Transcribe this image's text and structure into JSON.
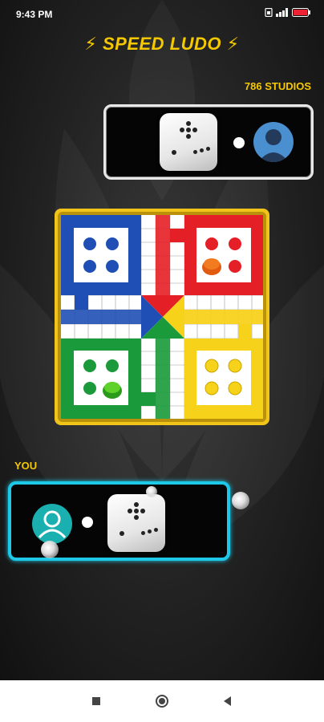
{
  "status_bar": {
    "time": "9:43 PM",
    "icons": [
      "sim-icon",
      "signal-icon",
      "battery-icon"
    ],
    "battery": "11"
  },
  "header": {
    "title": "SPEED LUDO",
    "bolt_left": "⚡",
    "bolt_right": "⚡"
  },
  "opponent": {
    "name": "786 STUDIOS",
    "dice_icon": "dice-icon",
    "avatar_icon": "user-avatar-icon"
  },
  "player": {
    "name": "YOU",
    "dice_icon": "dice-icon",
    "avatar_icon": "user-avatar-icon"
  },
  "board": {
    "colors": {
      "blue": "#1f4fb5",
      "red": "#e41f25",
      "green": "#1a9a3a",
      "yellow": "#f7d21b",
      "frame": "#f0c419"
    }
  },
  "nav": {
    "recent_icon": "square-icon",
    "home_icon": "circle-icon",
    "back_icon": "triangle-back-icon"
  }
}
